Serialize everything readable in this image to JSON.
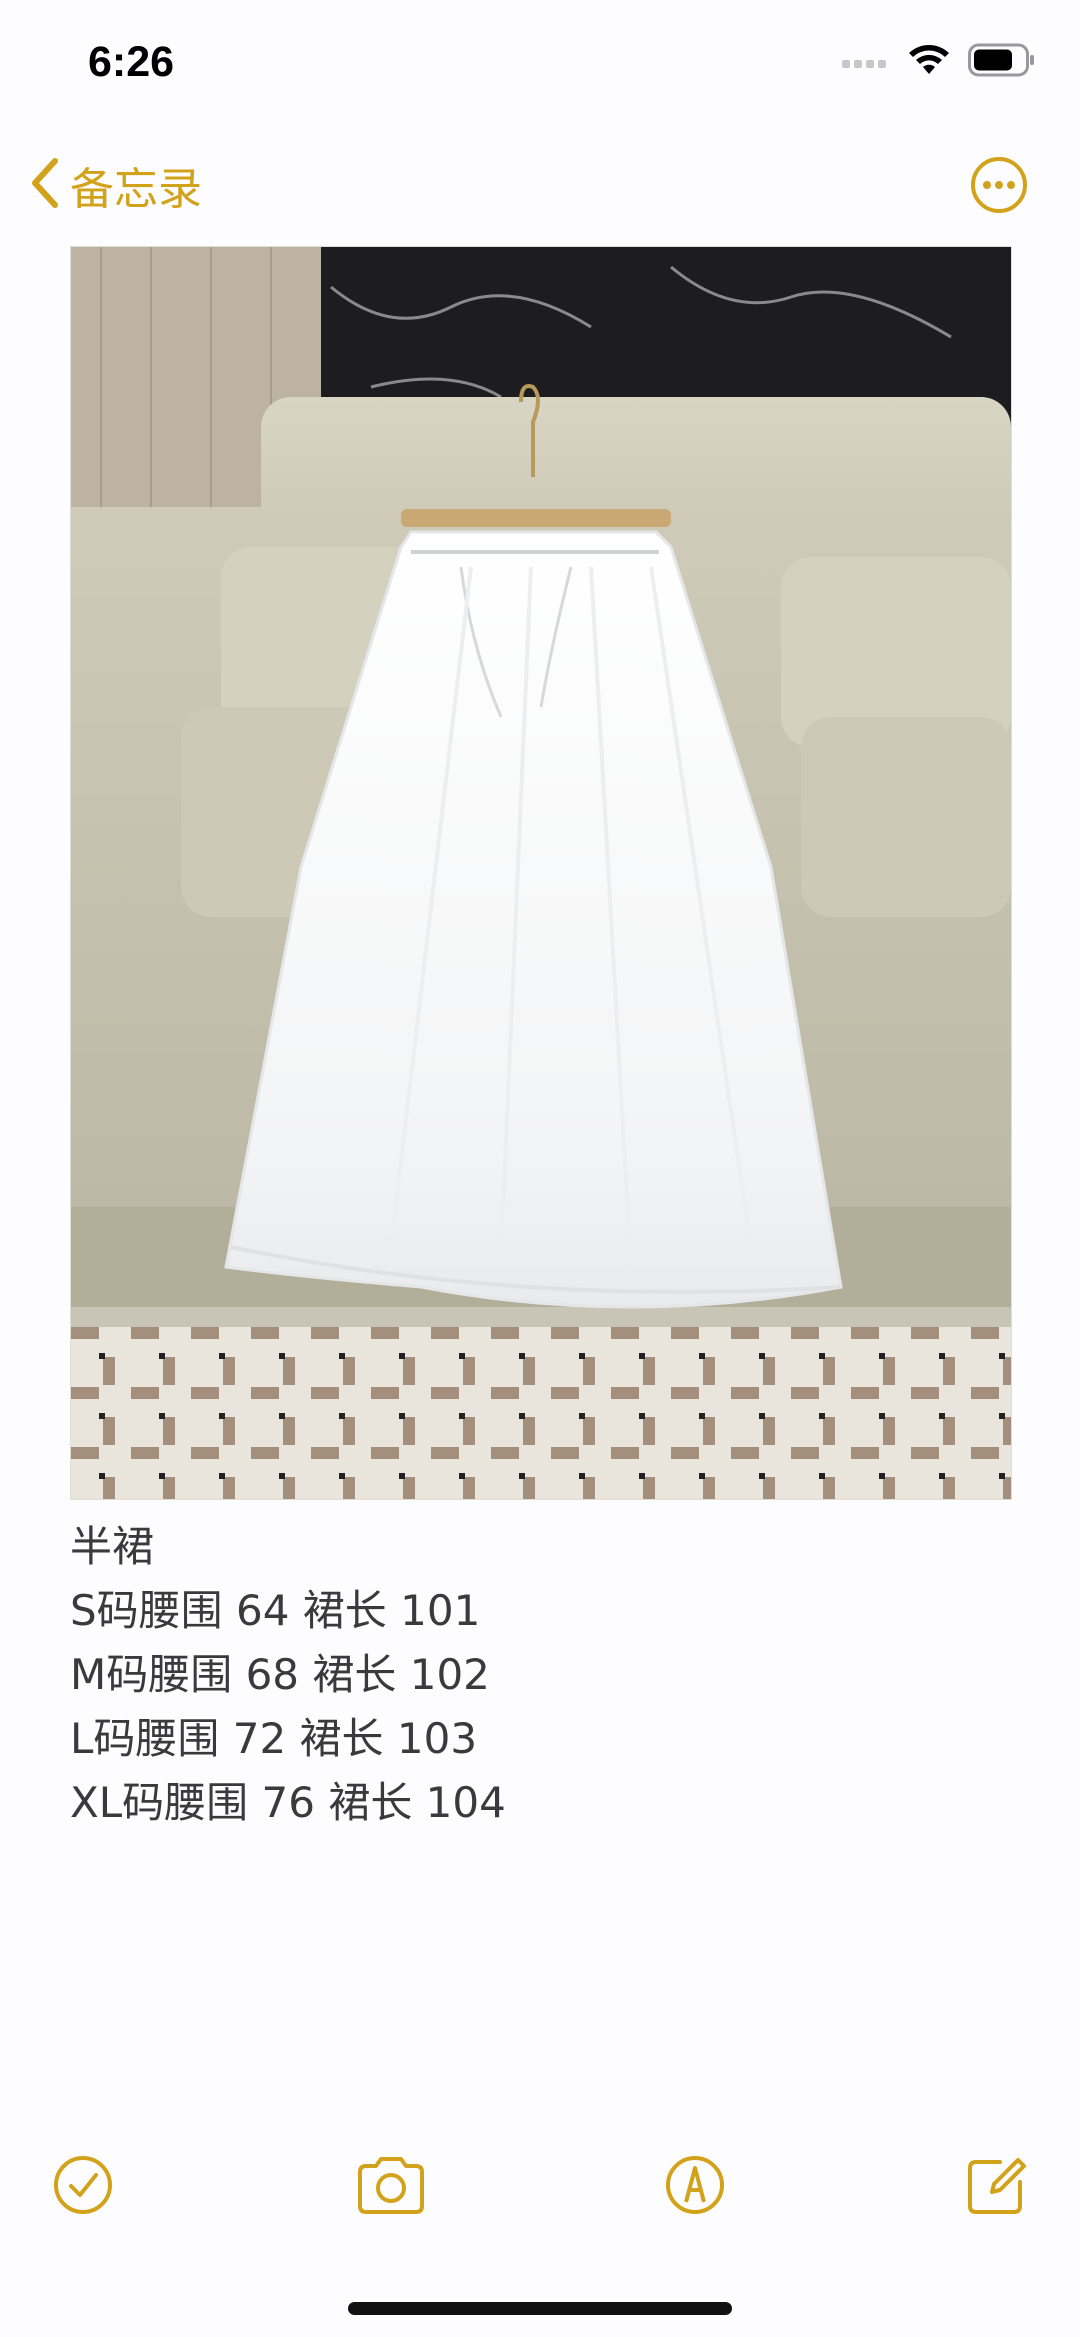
{
  "status": {
    "time": "6:26",
    "icons": [
      "signal-icon",
      "wifi-icon",
      "battery-icon"
    ]
  },
  "nav": {
    "back_label": "备忘录",
    "more_icon": "ellipsis-circle-icon"
  },
  "note": {
    "image_alt": "white long chiffon skirt on hanger over beige sofa",
    "lines": [
      "半裙",
      "S码腰围 64 裙长 101",
      "M码腰围 68 裙长 102",
      "L码腰围 72 裙长 103",
      "XL码腰围 76 裙长 104"
    ]
  },
  "toolbar": {
    "items": [
      "checklist-icon",
      "camera-icon",
      "markup-pen-icon",
      "compose-icon"
    ]
  },
  "colors": {
    "accent": "#d2a21a",
    "background": "#fdfcfe",
    "text": "#3a3a3a"
  }
}
